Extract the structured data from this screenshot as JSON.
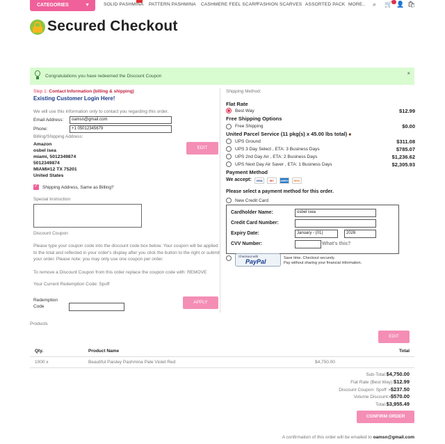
{
  "nav": {
    "categories_label": "CATEGORIES",
    "items": [
      "SOLID PASHMINA",
      "PATTERN PASHMINA",
      "CASHMERE FEEL SCARF",
      "FASHION SCARVES",
      "ASSORTED PACK",
      "MORE.."
    ]
  },
  "title": "Secured Checkout",
  "banner": {
    "text": "Congratulations you have redeemed the Discount Coupon",
    "close": "×"
  },
  "step": {
    "step_label": "Step 1:",
    "step_title": "Contact Information (billing & shipping)",
    "existing": "Existing Customer",
    "login": "Login Here!",
    "info_pre": "We will use this information",
    "info_only": "only",
    "info_post": "to contact you regarding this order."
  },
  "contact": {
    "email_label": "Email Address:",
    "email_value": "oamsn@gmail.com",
    "phone_label": "Phone:",
    "phone_value": "+1 05012345679"
  },
  "address": {
    "heading": "Billing/Shipping Address:",
    "lines": [
      "Amazon",
      "osbel isea",
      "miami, 5012349874",
      "5012349874",
      "MIAMI#12 TX 75201",
      "United States"
    ],
    "edit_label": "EDIT",
    "same_label": "Shipping Address, Same as Billing?"
  },
  "special": {
    "label": "Special Instruction"
  },
  "coupon": {
    "heading": "Discount Coupon",
    "para1": "Please type your coupon code into the discount code box below. Your coupon will be applied",
    "para2": "to the total and reflected in your order's display after you click the button to the right or submit",
    "para3": "your order. Please note: you may only use one coupon per order.",
    "remove_text": "To remove a Discount Coupon from this order replace the coupon code with: REMOVE",
    "current": "Your Current Redemption Code: Spoff",
    "redemption_label_1": "Redemption",
    "redemption_label_2": "Code",
    "apply_label": "APPLY"
  },
  "shipping": {
    "heading": "Shipping Method:",
    "flat_rate": "Flat Rate",
    "best_way": "Best Way",
    "best_way_price": "$12.99",
    "free_heading": "Free Shipping Options",
    "free_name": "Free Shipping",
    "free_price": "$0.00",
    "ups_heading": "United Parcel Service (11 pkg(s) x 45.00 lbs total)",
    "ups": [
      {
        "name": "UPS Ground",
        "price": "$311.08"
      },
      {
        "name": "UPS 3 Day Select , ETA: 3 Business Days",
        "price": "$785.07"
      },
      {
        "name": "UPS 2nd Day Air , ETA: 2 Business Days",
        "price": "$1,236.62"
      },
      {
        "name": "UPS Next Day Air Saver , ETA: 1 Business Days",
        "price": "$2,305.93"
      }
    ]
  },
  "payment": {
    "heading": "Payment Method",
    "we_accept": "We accept:",
    "logos": [
      "VISA",
      "MC",
      "AMEX",
      "DISC"
    ],
    "select_text": "Please select a payment method for this order.",
    "new_card": "New Credit Card",
    "cardholder_label": "Cardholder Name:",
    "cardholder_value": "osbel isea",
    "number_label": "Credit Card Number:",
    "number_value": "",
    "expiry_label": "Expiry Date:",
    "expiry_month": "January - (01)",
    "expiry_year": "2026",
    "cvv_label": "CVV Number:",
    "cvv_value": "",
    "whats_this": "What's this?",
    "paypal_top": "Checkout with",
    "paypal_brand": "PayPal",
    "paypal_note_1": "Save time. Checkout securely.",
    "paypal_note_2": "Pay without sharing your financial information."
  },
  "products": {
    "heading": "Products",
    "edit_label": "EDIT",
    "col_qty": "Qty.",
    "col_name": "Product Name",
    "col_total": "Total",
    "rows": [
      {
        "qty": "1000 x",
        "name": "Beautiful Paisley Pashmina Pale Violet Red",
        "price": "$4,750.00"
      }
    ]
  },
  "summary": {
    "subtotal_label": "Sub-Total:",
    "subtotal": "$4,750.00",
    "flat_label": "Flat Rate (Best Way):",
    "flat": "$12.99",
    "coupon_label": "Discount Coupon: Spoff :",
    "coupon": "-$237.50",
    "volume_label": "Volume Discount:",
    "volume": "-$570.00",
    "total_label": "Total:",
    "total": "$3,955.49"
  },
  "confirm_label": "CONFIRM ORDER",
  "footer": {
    "text": "A confirmation of this order will be emailed to",
    "email": "oamsn@gmail.com"
  },
  "colors": {
    "accent": "#f0609a",
    "button": "#f48eb5",
    "banner": "#d9fbd0",
    "link": "#1a3c8c",
    "step": "#e03050"
  }
}
